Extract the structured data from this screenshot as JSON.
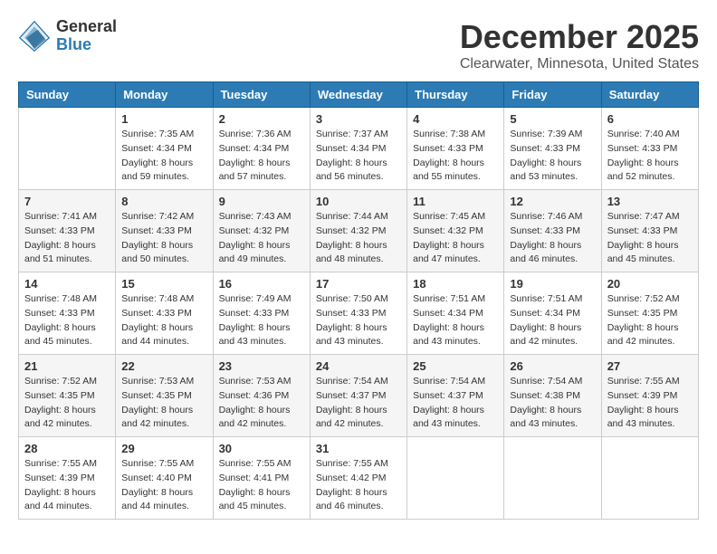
{
  "header": {
    "logo_general": "General",
    "logo_blue": "Blue",
    "title": "December 2025",
    "subtitle": "Clearwater, Minnesota, United States"
  },
  "weekdays": [
    "Sunday",
    "Monday",
    "Tuesday",
    "Wednesday",
    "Thursday",
    "Friday",
    "Saturday"
  ],
  "weeks": [
    [
      {
        "day": "",
        "info": ""
      },
      {
        "day": "1",
        "info": "Sunrise: 7:35 AM\nSunset: 4:34 PM\nDaylight: 8 hours\nand 59 minutes."
      },
      {
        "day": "2",
        "info": "Sunrise: 7:36 AM\nSunset: 4:34 PM\nDaylight: 8 hours\nand 57 minutes."
      },
      {
        "day": "3",
        "info": "Sunrise: 7:37 AM\nSunset: 4:34 PM\nDaylight: 8 hours\nand 56 minutes."
      },
      {
        "day": "4",
        "info": "Sunrise: 7:38 AM\nSunset: 4:33 PM\nDaylight: 8 hours\nand 55 minutes."
      },
      {
        "day": "5",
        "info": "Sunrise: 7:39 AM\nSunset: 4:33 PM\nDaylight: 8 hours\nand 53 minutes."
      },
      {
        "day": "6",
        "info": "Sunrise: 7:40 AM\nSunset: 4:33 PM\nDaylight: 8 hours\nand 52 minutes."
      }
    ],
    [
      {
        "day": "7",
        "info": "Sunrise: 7:41 AM\nSunset: 4:33 PM\nDaylight: 8 hours\nand 51 minutes."
      },
      {
        "day": "8",
        "info": "Sunrise: 7:42 AM\nSunset: 4:33 PM\nDaylight: 8 hours\nand 50 minutes."
      },
      {
        "day": "9",
        "info": "Sunrise: 7:43 AM\nSunset: 4:32 PM\nDaylight: 8 hours\nand 49 minutes."
      },
      {
        "day": "10",
        "info": "Sunrise: 7:44 AM\nSunset: 4:32 PM\nDaylight: 8 hours\nand 48 minutes."
      },
      {
        "day": "11",
        "info": "Sunrise: 7:45 AM\nSunset: 4:32 PM\nDaylight: 8 hours\nand 47 minutes."
      },
      {
        "day": "12",
        "info": "Sunrise: 7:46 AM\nSunset: 4:33 PM\nDaylight: 8 hours\nand 46 minutes."
      },
      {
        "day": "13",
        "info": "Sunrise: 7:47 AM\nSunset: 4:33 PM\nDaylight: 8 hours\nand 45 minutes."
      }
    ],
    [
      {
        "day": "14",
        "info": "Sunrise: 7:48 AM\nSunset: 4:33 PM\nDaylight: 8 hours\nand 45 minutes."
      },
      {
        "day": "15",
        "info": "Sunrise: 7:48 AM\nSunset: 4:33 PM\nDaylight: 8 hours\nand 44 minutes."
      },
      {
        "day": "16",
        "info": "Sunrise: 7:49 AM\nSunset: 4:33 PM\nDaylight: 8 hours\nand 43 minutes."
      },
      {
        "day": "17",
        "info": "Sunrise: 7:50 AM\nSunset: 4:33 PM\nDaylight: 8 hours\nand 43 minutes."
      },
      {
        "day": "18",
        "info": "Sunrise: 7:51 AM\nSunset: 4:34 PM\nDaylight: 8 hours\nand 43 minutes."
      },
      {
        "day": "19",
        "info": "Sunrise: 7:51 AM\nSunset: 4:34 PM\nDaylight: 8 hours\nand 42 minutes."
      },
      {
        "day": "20",
        "info": "Sunrise: 7:52 AM\nSunset: 4:35 PM\nDaylight: 8 hours\nand 42 minutes."
      }
    ],
    [
      {
        "day": "21",
        "info": "Sunrise: 7:52 AM\nSunset: 4:35 PM\nDaylight: 8 hours\nand 42 minutes."
      },
      {
        "day": "22",
        "info": "Sunrise: 7:53 AM\nSunset: 4:35 PM\nDaylight: 8 hours\nand 42 minutes."
      },
      {
        "day": "23",
        "info": "Sunrise: 7:53 AM\nSunset: 4:36 PM\nDaylight: 8 hours\nand 42 minutes."
      },
      {
        "day": "24",
        "info": "Sunrise: 7:54 AM\nSunset: 4:37 PM\nDaylight: 8 hours\nand 42 minutes."
      },
      {
        "day": "25",
        "info": "Sunrise: 7:54 AM\nSunset: 4:37 PM\nDaylight: 8 hours\nand 43 minutes."
      },
      {
        "day": "26",
        "info": "Sunrise: 7:54 AM\nSunset: 4:38 PM\nDaylight: 8 hours\nand 43 minutes."
      },
      {
        "day": "27",
        "info": "Sunrise: 7:55 AM\nSunset: 4:39 PM\nDaylight: 8 hours\nand 43 minutes."
      }
    ],
    [
      {
        "day": "28",
        "info": "Sunrise: 7:55 AM\nSunset: 4:39 PM\nDaylight: 8 hours\nand 44 minutes."
      },
      {
        "day": "29",
        "info": "Sunrise: 7:55 AM\nSunset: 4:40 PM\nDaylight: 8 hours\nand 44 minutes."
      },
      {
        "day": "30",
        "info": "Sunrise: 7:55 AM\nSunset: 4:41 PM\nDaylight: 8 hours\nand 45 minutes."
      },
      {
        "day": "31",
        "info": "Sunrise: 7:55 AM\nSunset: 4:42 PM\nDaylight: 8 hours\nand 46 minutes."
      },
      {
        "day": "",
        "info": ""
      },
      {
        "day": "",
        "info": ""
      },
      {
        "day": "",
        "info": ""
      }
    ]
  ]
}
